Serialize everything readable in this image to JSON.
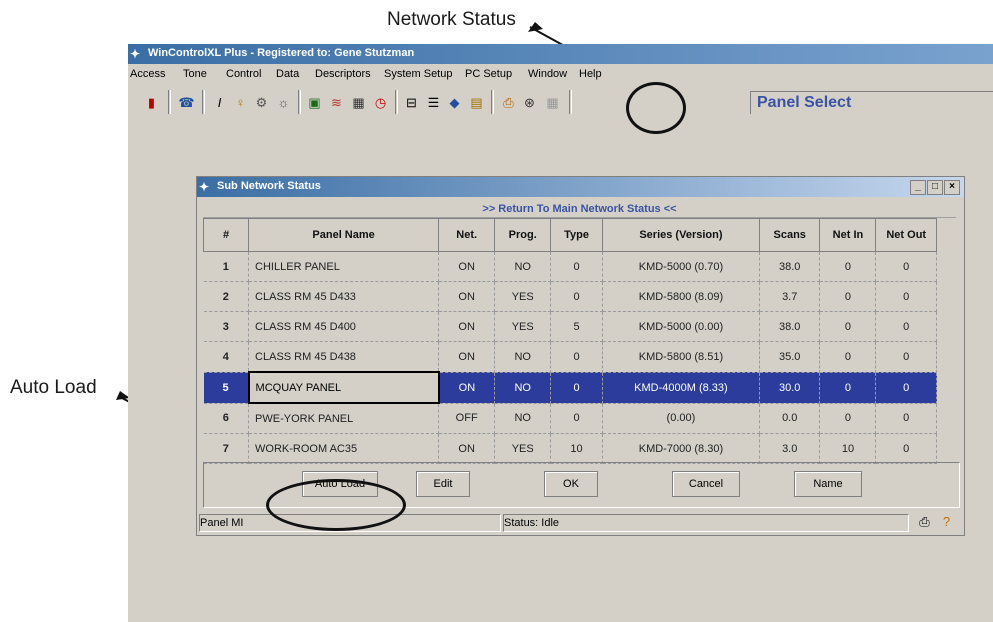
{
  "callouts": {
    "network_status": "Network Status",
    "auto_load": "Auto Load"
  },
  "app": {
    "title": "WinControlXL Plus - Registered to: Gene Stutzman",
    "menu": [
      "Access",
      "Tone",
      "Control",
      "Data",
      "Descriptors",
      "System Setup",
      "PC Setup",
      "Window",
      "Help"
    ],
    "panel_select": "Panel Select"
  },
  "dialog": {
    "title": "Sub Network Status",
    "return_link": ">> Return To Main Network Status <<",
    "columns": [
      "#",
      "Panel Name",
      "Net.",
      "Prog.",
      "Type",
      "Series (Version)",
      "Scans",
      "Net In",
      "Net Out"
    ],
    "rows": [
      {
        "num": "1",
        "name": "CHILLER PANEL",
        "net": "ON",
        "prog": "NO",
        "type": "0",
        "series": "KMD-5000 (0.70)",
        "scans": "38.0",
        "net_in": "0",
        "net_out": "0"
      },
      {
        "num": "2",
        "name": "CLASS RM 45 D433",
        "net": "ON",
        "prog": "YES",
        "type": "0",
        "series": "KMD-5800 (8.09)",
        "scans": "3.7",
        "net_in": "0",
        "net_out": "0"
      },
      {
        "num": "3",
        "name": "CLASS RM 45 D400",
        "net": "ON",
        "prog": "YES",
        "type": "5",
        "series": "KMD-5000 (0.00)",
        "scans": "38.0",
        "net_in": "0",
        "net_out": "0"
      },
      {
        "num": "4",
        "name": "CLASS RM 45 D438",
        "net": "ON",
        "prog": "NO",
        "type": "0",
        "series": "KMD-5800 (8.51)",
        "scans": "35.0",
        "net_in": "0",
        "net_out": "0"
      },
      {
        "num": "5",
        "name": "MCQUAY PANEL",
        "net": "ON",
        "prog": "NO",
        "type": "0",
        "series": "KMD-4000M (8.33)",
        "scans": "30.0",
        "net_in": "0",
        "net_out": "0"
      },
      {
        "num": "6",
        "name": "PWE-YORK PANEL",
        "net": "OFF",
        "prog": "NO",
        "type": "0",
        "series": "(0.00)",
        "scans": "0.0",
        "net_in": "0",
        "net_out": "0"
      },
      {
        "num": "7",
        "name": "WORK-ROOM AC35",
        "net": "ON",
        "prog": "YES",
        "type": "10",
        "series": "KMD-7000 (8.30)",
        "scans": "3.0",
        "net_in": "10",
        "net_out": "0"
      }
    ],
    "selected_row_index": 4,
    "buttons": {
      "auto_load": "Auto Load",
      "edit": "Edit",
      "ok": "OK",
      "cancel": "Cancel",
      "name": "Name"
    },
    "status": {
      "panel": "Panel MI",
      "state": "Status: Idle"
    }
  }
}
